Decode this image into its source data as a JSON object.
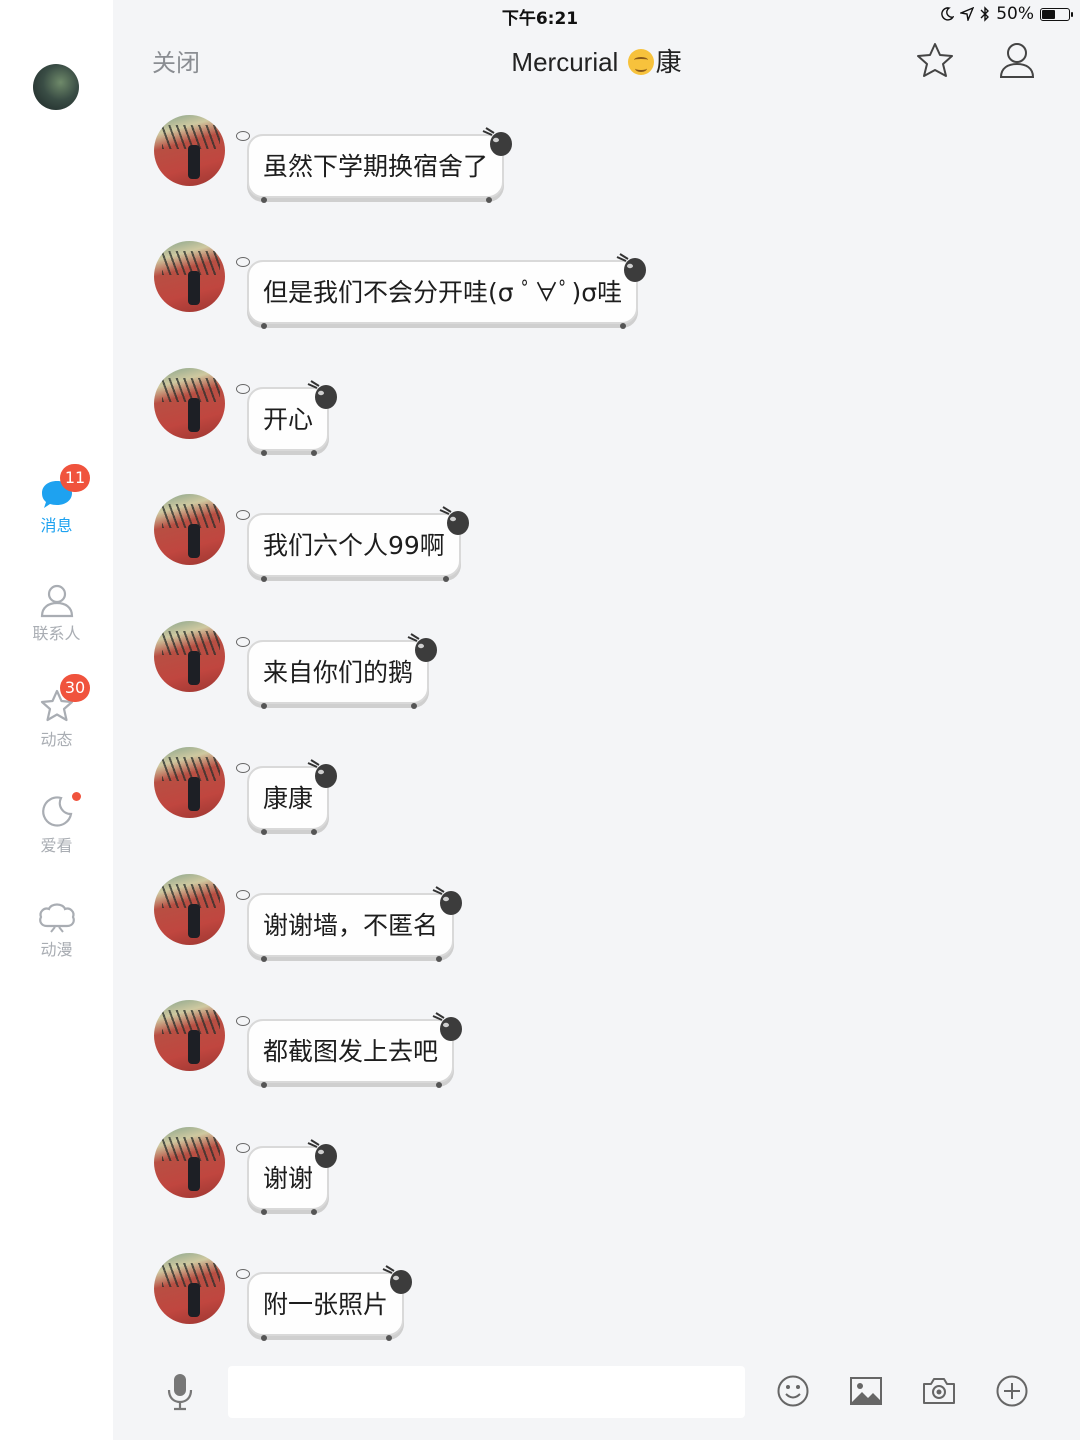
{
  "status_bar": {
    "device": "iPad",
    "time": "下午6:21",
    "battery_percent": "50%",
    "battery_level": 0.5
  },
  "sidebar": {
    "items": [
      {
        "label": "消息",
        "badge": "11",
        "icon": "chat-bubble-icon",
        "active": true
      },
      {
        "label": "联系人",
        "icon": "person-icon"
      },
      {
        "label": "动态",
        "badge": "30",
        "icon": "star-icon"
      },
      {
        "label": "爱看",
        "icon": "moon-icon",
        "dot": true
      },
      {
        "label": "动漫",
        "icon": "cloud-face-icon"
      }
    ]
  },
  "header": {
    "close_label": "关闭",
    "title_prefix": "Mercurial ",
    "title_suffix": "康",
    "emoji_icon": "upside-down-face-icon"
  },
  "messages": [
    {
      "text": "虽然下学期换宿舍了"
    },
    {
      "text": "但是我们不会分开哇(σ ﾟ∀ﾟ)σ哇"
    },
    {
      "text": "开心"
    },
    {
      "text": "我们六个人99啊"
    },
    {
      "text": "来自你们的鹅"
    },
    {
      "text": "康康"
    },
    {
      "text": "谢谢墙，不匿名"
    },
    {
      "text": "都截图发上去吧"
    },
    {
      "text": "谢谢"
    },
    {
      "text": "附一张照片"
    }
  ],
  "input_bar": {
    "placeholder": "",
    "tools": [
      "microphone-icon",
      "emoji-icon",
      "image-icon",
      "camera-icon",
      "plus-icon"
    ]
  },
  "colors": {
    "accent": "#1ea2f0",
    "badge": "#f0533d",
    "inactive": "#a9adb3"
  }
}
